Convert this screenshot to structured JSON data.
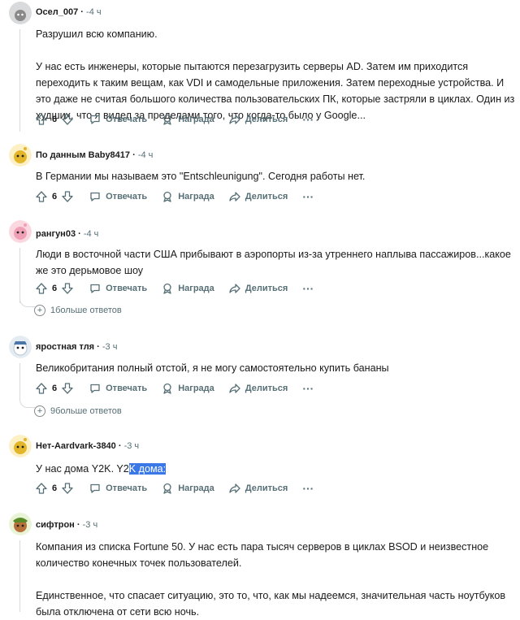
{
  "labels": {
    "reply": "Отвечать",
    "award": "Награда",
    "share": "Делиться",
    "more_dots": "···"
  },
  "comments": [
    {
      "user": "Осел_007",
      "time": "-4 ч",
      "votes": "6",
      "paragraphs": [
        "Разрушил всю компанию.",
        "У нас есть инженеры, которые пытаются перезагрузить серверы AD. Затем им приходится переходить к таким вещам, как VDI и самодельные приложения. Затем переходные устройства. И это даже не считая большого количества пользовательских ПК, которые застряли в циклах. Один из худших, что я видел за пределами того, что когда-то было у Google..."
      ]
    },
    {
      "user": "По данным Baby8417",
      "time": "-4 ч",
      "votes": "6",
      "paragraphs": [
        "В Германии мы называем это \"Entschleunigung\". Сегодня работы нет."
      ]
    },
    {
      "user": "рангун03",
      "time": "-4 ч",
      "votes": "6",
      "paragraphs": [
        "Люди в восточной части США прибывают в аэропорты из-за утреннего наплыва пассажиров...какое же это дерьмовое шоу"
      ],
      "more": "1больше ответов"
    },
    {
      "user": "яростная тля",
      "time": "-3 ч",
      "votes": "6",
      "paragraphs": [
        "Великобритания полный отстой, я не могу самостоятельно купить бананы"
      ],
      "more": "9больше ответов"
    },
    {
      "user": "Нет-Aardvark-3840",
      "time": "-3 ч",
      "votes": "6",
      "text_plain": "У нас дома Y2K. Y2",
      "text_selected": "K дома:"
    },
    {
      "user": "сифтрон",
      "time": "-3 ч",
      "paragraphs": [
        "Компания из списка Fortune 50. У нас есть пара тысяч серверов в циклах BSOD и неизвестное количество конечных точек пользователей.",
        "Единственное, что спасает ситуацию, это то, что, как мы надеемся, значительная часть ноутбуков была отключена от сети всю ночь."
      ]
    }
  ]
}
